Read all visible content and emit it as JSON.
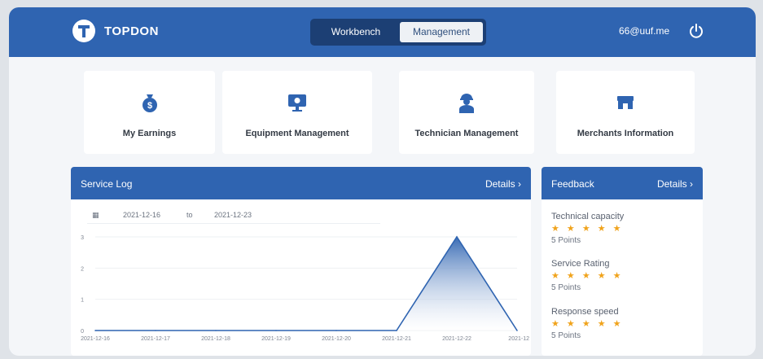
{
  "header": {
    "brand": "TOPDON",
    "tabs": {
      "workbench": "Workbench",
      "management": "Management"
    },
    "user_email": "66@uuf.me"
  },
  "cards": [
    {
      "label": "My Earnings",
      "icon": "money-bag-icon"
    },
    {
      "label": "Equipment Management",
      "icon": "monitor-icon"
    },
    {
      "label": "Technician Management",
      "icon": "technician-icon"
    },
    {
      "label": "Merchants Information",
      "icon": "store-icon"
    }
  ],
  "service_log": {
    "title": "Service Log",
    "details": "Details",
    "date_from": "2021-12-16",
    "date_sep": "to",
    "date_to": "2021-12-23"
  },
  "feedback": {
    "title": "Feedback",
    "details": "Details",
    "items": [
      {
        "label": "Technical capacity",
        "stars": "★ ★ ★ ★ ★",
        "points": "5 Points"
      },
      {
        "label": "Service Rating",
        "stars": "★ ★ ★ ★ ★",
        "points": "5 Points"
      },
      {
        "label": "Response speed",
        "stars": "★ ★ ★ ★ ★",
        "points": "5 Points"
      }
    ]
  },
  "chart_data": {
    "type": "area",
    "categories": [
      "2021-12-16",
      "2021-12-17",
      "2021-12-18",
      "2021-12-19",
      "2021-12-20",
      "2021-12-21",
      "2021-12-22",
      "2021-12"
    ],
    "values": [
      0,
      0,
      0,
      0,
      0,
      0,
      3,
      0
    ],
    "yticks": [
      "0",
      "1",
      "2",
      "3"
    ],
    "ylim": [
      0,
      3
    ],
    "colors": {
      "line": "#2f64b1",
      "fill_top": "#2f64b1",
      "fill_bottom": "#ffffff"
    }
  },
  "colors": {
    "primary": "#2f64b1",
    "star": "#f0a31c"
  }
}
